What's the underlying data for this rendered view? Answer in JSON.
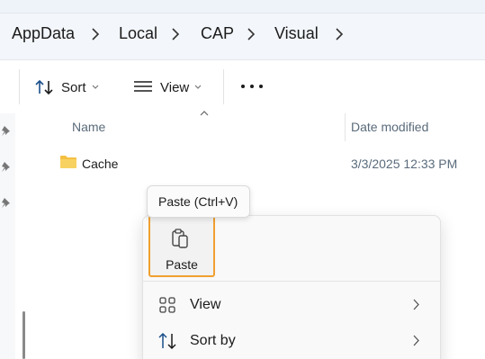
{
  "breadcrumbs": [
    "AppData",
    "Local",
    "CAP",
    "Visual"
  ],
  "toolbar": {
    "sort_label": "Sort",
    "view_label": "View",
    "more_icon": "more-horizontal-icon"
  },
  "columns": {
    "name": "Name",
    "date_modified": "Date modified"
  },
  "files": [
    {
      "name": "Cache",
      "date_modified": "3/3/2025 12:33 PM",
      "icon": "folder-icon"
    }
  ],
  "tooltip": "Paste (Ctrl+V)",
  "context_menu": {
    "paste_label": "Paste",
    "items": [
      {
        "label": "View",
        "icon": "grid-view-icon",
        "has_submenu": true
      },
      {
        "label": "Sort by",
        "icon": "sort-icon",
        "has_submenu": true
      }
    ]
  },
  "colors": {
    "accent_focus": "#f0a030",
    "folder": "#f4c042",
    "address_bg": "#f3f6fa"
  }
}
